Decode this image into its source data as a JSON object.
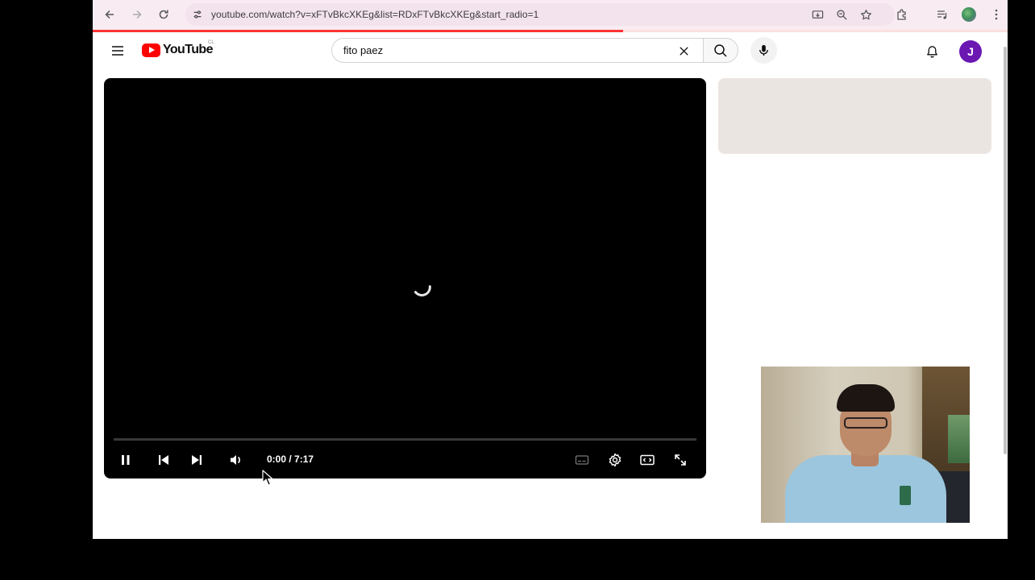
{
  "browser": {
    "url": "youtube.com/watch?v=xFTvBkcXKEg&list=RDxFTvBkcXKEg&start_radio=1",
    "icons": [
      "back-icon",
      "forward-icon",
      "reload-icon",
      "site-info-icon",
      "install-app-icon",
      "zoom-icon",
      "bookmark-star-icon",
      "extensions-icon",
      "media-controls-icon",
      "profile-icon",
      "menu-dots-icon"
    ],
    "page_load_progress": 0.58
  },
  "youtube": {
    "logo_text": "YouTube",
    "region_code": "CL",
    "search_query": "fito paez",
    "avatar_letter": "J",
    "avatar_color": "#6b18b3"
  },
  "player": {
    "time_display": "0:00 / 7:17",
    "state": "loading",
    "played_fraction": 0.0,
    "controls": [
      "pause-icon",
      "previous-icon",
      "next-icon",
      "volume-icon",
      "subtitles-icon",
      "settings-gear-icon",
      "theater-mode-icon",
      "fullscreen-icon"
    ]
  },
  "colors": {
    "brand_red": "#ff0000",
    "toolbar_bg": "#f8ecf2",
    "placeholder_bg": "#ebe5e2"
  }
}
